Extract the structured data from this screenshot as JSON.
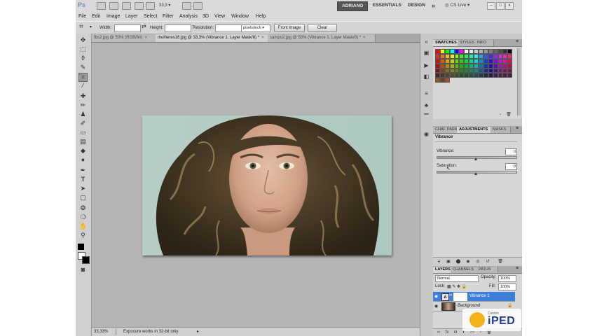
{
  "appbar": {
    "logo": "Ps",
    "zoom": "33,3",
    "workspaces": [
      "ADRIANO",
      "ESSENTIALS",
      "DESIGN"
    ],
    "more": "»",
    "cs_live": "CS Live",
    "win_min": "–",
    "win_max": "□",
    "win_close": "x"
  },
  "menu": [
    "File",
    "Edit",
    "Image",
    "Layer",
    "Select",
    "Filter",
    "Analysis",
    "3D",
    "View",
    "Window",
    "Help"
  ],
  "options": {
    "width_label": "Width:",
    "height_label": "Height:",
    "resolution_label": "Resolution:",
    "unit": "pixels/inch",
    "front_image": "Front Image",
    "clear": "Clear"
  },
  "tabs": [
    "fbs2.jpg @ 50% (RGB/8#)",
    "mulheres16.jpg @ 33,3% (Vibrance 1, Layer Mask/8) *",
    "campo2.jpg @ 50% (Vibrance 1, Layer Mask/8) *"
  ],
  "tab_close": "×",
  "status": {
    "zoom": "33,33%",
    "info": "Exposure works in 32-bit only"
  },
  "panels": {
    "swatches_tabs": [
      "SWATCHES",
      "STYLES",
      "INFO"
    ],
    "adj_tabs": [
      "CHAR",
      "PARA",
      "ADJUSTMENTS",
      "MASKS"
    ],
    "adjustment_title": "Vibrance",
    "vibrance_label": "Vibrance:",
    "vibrance_value": "0",
    "saturation_label": "Saturation:",
    "saturation_value": "0",
    "vibrance_level": 0.5,
    "saturation_level": 0.5,
    "layers_tabs": [
      "LAYERS",
      "CHANNELS",
      "PATHS"
    ],
    "blend_mode": "Normal",
    "opacity_label": "Opacity:",
    "opacity_value": "100%",
    "lock_label": "Lock:",
    "fill_label": "Fill:",
    "fill_value": "100%",
    "layers": [
      {
        "name": "Vibrance 1",
        "selected": true
      },
      {
        "name": "Background",
        "selected": false
      }
    ]
  },
  "watermark": {
    "small": "Cursos",
    "brand": "iPED"
  },
  "colors": {
    "accent": "#3d7fdc",
    "watermark_orange": "#f4b21a"
  }
}
